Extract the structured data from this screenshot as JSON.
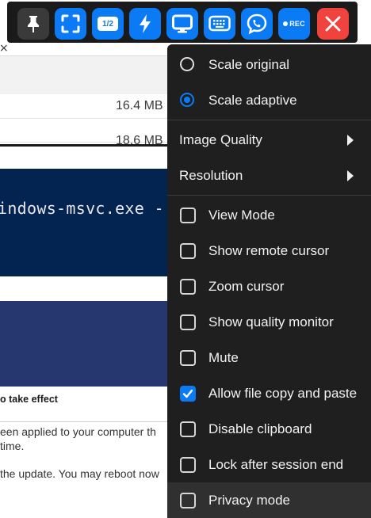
{
  "background": {
    "file_sizes": [
      "16.4 MB",
      "18.6 MB"
    ],
    "terminal_text": "indows-msvc.exe -",
    "status_heading": "o take effect",
    "status_lines": [
      "een applied to your computer th",
      " time.",
      "the update. You may reboot now"
    ]
  },
  "toolbar": {
    "buttons": [
      {
        "name": "pin",
        "icon": "pin-icon"
      },
      {
        "name": "fullscreen",
        "icon": "fullscreen-icon"
      },
      {
        "name": "scale",
        "icon": "ratio-badge-icon",
        "label": "1/2"
      },
      {
        "name": "actions",
        "icon": "lightning-icon"
      },
      {
        "name": "display",
        "icon": "monitor-icon"
      },
      {
        "name": "keyboard",
        "icon": "keyboard-icon"
      },
      {
        "name": "chat",
        "icon": "chat-bubble-icon"
      },
      {
        "name": "record",
        "icon": "record-icon",
        "label": "REC"
      },
      {
        "name": "close",
        "icon": "close-icon"
      }
    ]
  },
  "menu": {
    "scale_original": {
      "label": "Scale original",
      "selected": false
    },
    "scale_adaptive": {
      "label": "Scale adaptive",
      "selected": true
    },
    "image_quality": {
      "label": "Image Quality"
    },
    "resolution": {
      "label": "Resolution"
    },
    "view_mode": {
      "label": "View Mode",
      "checked": false
    },
    "show_remote_cursor": {
      "label": "Show remote cursor",
      "checked": false
    },
    "zoom_cursor": {
      "label": "Zoom cursor",
      "checked": false
    },
    "show_quality_monitor": {
      "label": "Show quality monitor",
      "checked": false
    },
    "mute": {
      "label": "Mute",
      "checked": false
    },
    "allow_file_copy": {
      "label": "Allow file copy and paste",
      "checked": true
    },
    "disable_clipboard": {
      "label": "Disable clipboard",
      "checked": false
    },
    "lock_after_session": {
      "label": "Lock after session end",
      "checked": false
    },
    "privacy_mode": {
      "label": "Privacy mode",
      "checked": false,
      "hovered": true
    }
  },
  "colors": {
    "accent": "#0a7bf5",
    "toolbar_bg": "#1a1a1a",
    "menu_bg": "#1f1f1f",
    "close_red": "#f0433e"
  }
}
